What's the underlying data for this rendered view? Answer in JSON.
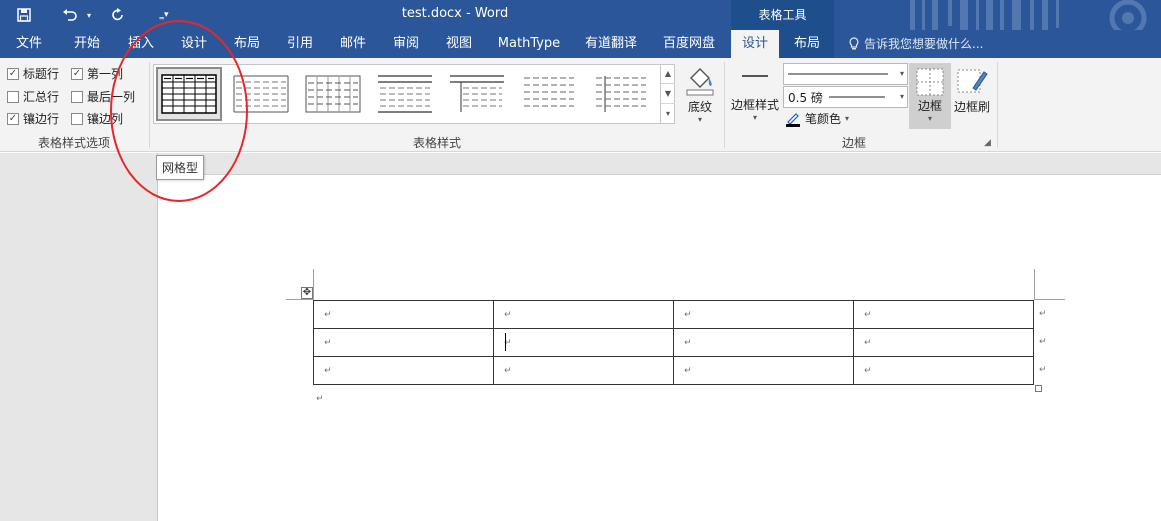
{
  "window": {
    "title": "test.docx - Word",
    "context_title": "表格工具",
    "tell_me": "告诉我您想要做什么..."
  },
  "tabs": [
    {
      "label": "文件",
      "active": false
    },
    {
      "label": "开始",
      "active": false
    },
    {
      "label": "插入",
      "active": false
    },
    {
      "label": "设计",
      "active": false
    },
    {
      "label": "布局",
      "active": false
    },
    {
      "label": "引用",
      "active": false
    },
    {
      "label": "邮件",
      "active": false
    },
    {
      "label": "审阅",
      "active": false
    },
    {
      "label": "视图",
      "active": false
    },
    {
      "label": "MathType",
      "active": false
    },
    {
      "label": "有道翻译",
      "active": false
    },
    {
      "label": "百度网盘",
      "active": false
    },
    {
      "label": "设计",
      "active": true
    },
    {
      "label": "布局",
      "active": false
    }
  ],
  "ribbon": {
    "style_options": {
      "group_label": "表格样式选项",
      "items": [
        {
          "label": "标题行",
          "checked": true
        },
        {
          "label": "第一列",
          "checked": true
        },
        {
          "label": "汇总行",
          "checked": false
        },
        {
          "label": "最后一列",
          "checked": false
        },
        {
          "label": "镶边行",
          "checked": true
        },
        {
          "label": "镶边列",
          "checked": false
        }
      ]
    },
    "table_styles": {
      "group_label": "表格样式",
      "shading_label": "底纹"
    },
    "borders": {
      "group_label": "边框",
      "border_styles_label": "边框样式",
      "pen_weight": "0.5 磅",
      "pen_color_label": "笔颜色",
      "borders_label": "边框",
      "border_painter_label": "边框刷"
    }
  },
  "tooltip": {
    "text": "网格型"
  },
  "colors": {
    "accent": "#2b579a",
    "context_tab": "#1e4e8c",
    "annotation": "#e8262b"
  },
  "document": {
    "paragraph_mark": "↵"
  }
}
